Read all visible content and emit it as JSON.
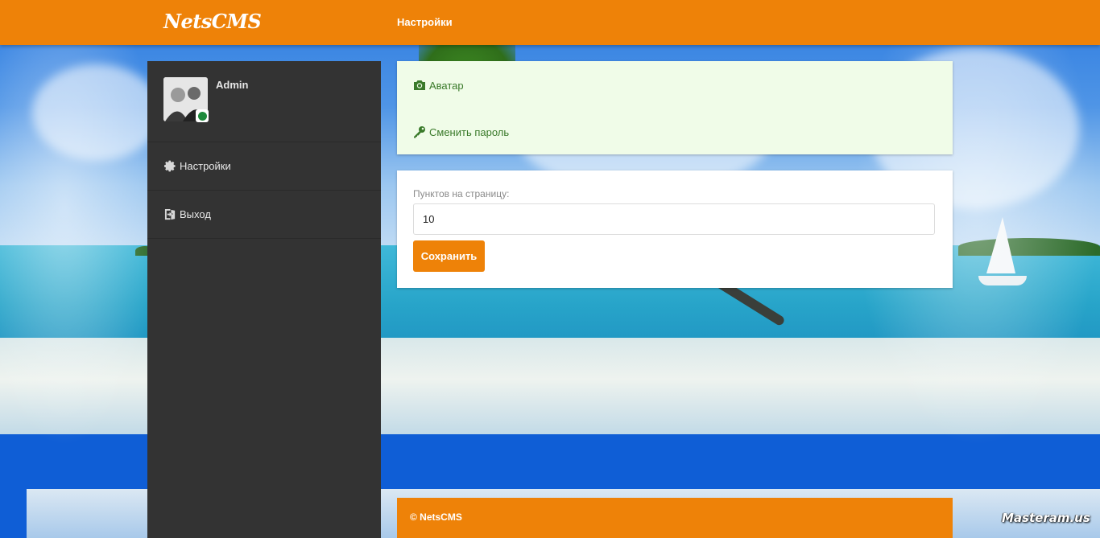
{
  "header": {
    "brand": "NetsCMS",
    "title": "Настройки"
  },
  "sidebar": {
    "user_name": "Admin",
    "items": [
      {
        "label": "Настройки",
        "icon": "gear-icon"
      },
      {
        "label": "Выход",
        "icon": "logout-icon"
      }
    ]
  },
  "links_panel": {
    "items": [
      {
        "label": "Аватар",
        "icon": "camera-icon"
      },
      {
        "label": "Сменить пароль",
        "icon": "key-icon"
      }
    ]
  },
  "settings_form": {
    "items_per_page_label": "Пунктов на страницу:",
    "items_per_page_value": "10",
    "save_label": "Сохранить"
  },
  "footer": {
    "text": "© NetsCMS"
  },
  "watermark": {
    "text": "Masteram.us"
  },
  "colors": {
    "accent": "#ee8208",
    "sidebar": "#333333",
    "links_panel_bg": "#f0fce8",
    "link_text": "#3a7a2a"
  }
}
